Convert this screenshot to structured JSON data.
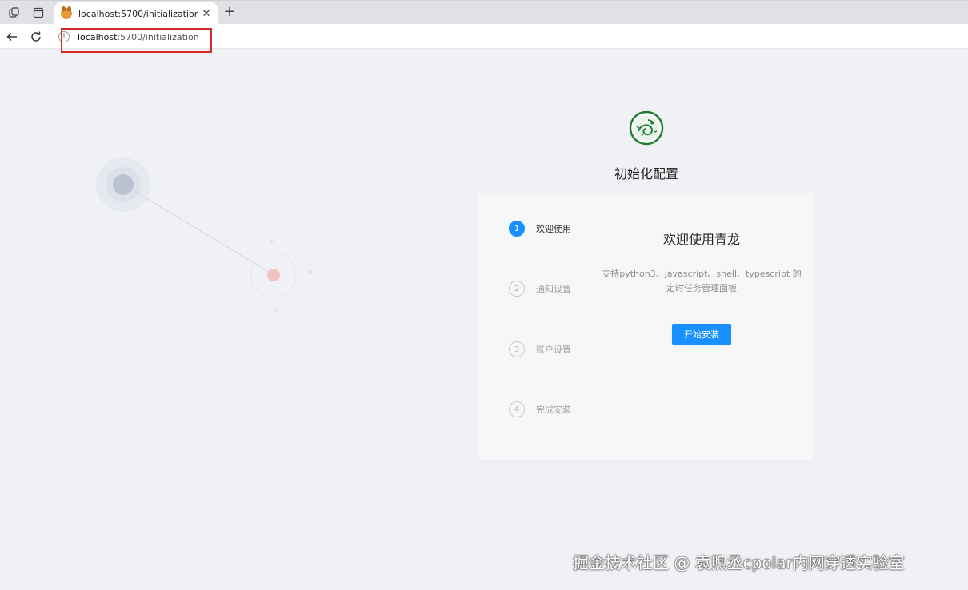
{
  "browser": {
    "tab_title": "localhost:5700/initialization",
    "close_glyph": "✕",
    "new_tab_glyph": "+",
    "url_host": "localhost",
    "url_rest": ":5700/initialization",
    "info_glyph": "i"
  },
  "page": {
    "title": "初始化配置",
    "steps": [
      {
        "number": "1",
        "label": "欢迎使用",
        "state": "active"
      },
      {
        "number": "2",
        "label": "通知设置",
        "state": "pending"
      },
      {
        "number": "3",
        "label": "账户设置",
        "state": "pending"
      },
      {
        "number": "4",
        "label": "完成安装",
        "state": "pending"
      }
    ],
    "welcome_title": "欢迎使用青龙",
    "description_line1": "支持python3、javascript、shell、typescript 的",
    "description_line2": "定时任务管理面板",
    "start_button": "开始安装"
  },
  "colors": {
    "accent": "#1890ff",
    "highlight_box": "#d42a2a",
    "logo_green": "#1e7e34"
  },
  "icons": [
    "workspaces-icon",
    "tab-actions-icon",
    "favicon",
    "close-icon",
    "new-tab-icon",
    "back-icon",
    "reload-icon",
    "info-icon",
    "qinglong-logo-icon"
  ],
  "watermark": "掘金技术社区 @ 袁煦丞cpolar内网穿透实验室"
}
